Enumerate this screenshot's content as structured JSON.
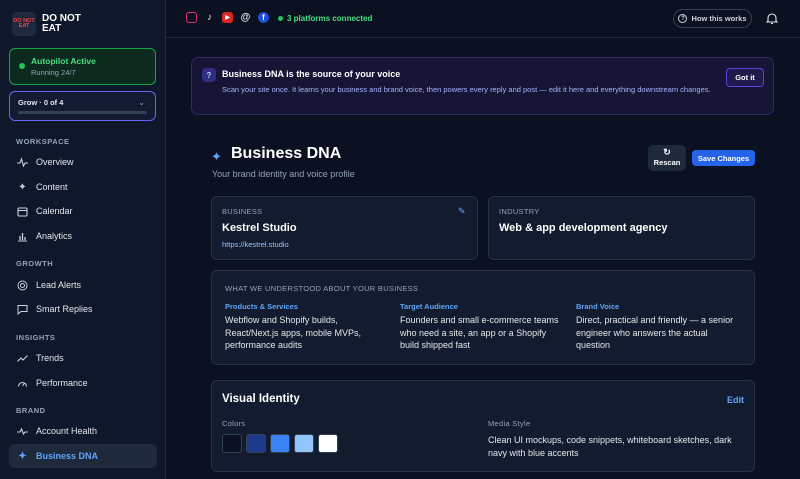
{
  "brand": {
    "logo_text": "DO NOT EAT",
    "name": "DO NOT EAT"
  },
  "autopilot": {
    "title": "Autopilot Active",
    "subtitle": "Running 24/7",
    "color": "#22c55e"
  },
  "grow": {
    "label": "Grow · 0 of 4",
    "progress": 0
  },
  "sidebar": {
    "sections": [
      "WORKSPACE",
      "GROWTH",
      "INSIGHTS",
      "BRAND"
    ],
    "items": [
      {
        "label": "Overview",
        "icon": "pulse-icon"
      },
      {
        "label": "Content",
        "icon": "sparkle-icon"
      },
      {
        "label": "Calendar",
        "icon": "calendar-icon"
      },
      {
        "label": "Analytics",
        "icon": "bar-chart-icon"
      },
      {
        "label": "Lead Alerts",
        "icon": "target-icon"
      },
      {
        "label": "Smart Replies",
        "icon": "chat-icon"
      },
      {
        "label": "Trends",
        "icon": "trend-up-icon"
      },
      {
        "label": "Performance",
        "icon": "gauge-icon"
      },
      {
        "label": "Account Health",
        "icon": "heartbeat-icon"
      },
      {
        "label": "Business DNA",
        "icon": "dna-icon",
        "active": true
      }
    ]
  },
  "topbar": {
    "platforms": [
      "instagram-icon",
      "tiktok-icon",
      "youtube-icon",
      "threads-icon",
      "facebook-icon"
    ],
    "connected": "3 platforms connected",
    "how_label": "How this works"
  },
  "banner": {
    "icon": "?",
    "title": "Business DNA is the source of your voice",
    "description": "Scan your site once. It learns your business and brand voice, then powers every reply and post — edit it here and everything downstream changes.",
    "button": "Got it"
  },
  "page": {
    "title": "Business DNA",
    "subtitle": "Your brand identity and voice profile",
    "rescan_label": "Rescan",
    "save_label": "Save Changes"
  },
  "business": {
    "label": "BUSINESS",
    "name": "Kestrel Studio",
    "url": "https://kestrel.studio"
  },
  "industry": {
    "label": "INDUSTRY",
    "value": "Web & app development agency"
  },
  "understood": {
    "label": "WHAT WE UNDERSTOOD ABOUT YOUR BUSINESS",
    "columns": [
      {
        "heading": "Products & Services",
        "text": "Webflow and Shopify builds, React/Next.js apps, mobile MVPs, performance audits"
      },
      {
        "heading": "Target Audience",
        "text": "Founders and small e-commerce teams who need a site, an app or a Shopify build shipped fast"
      },
      {
        "heading": "Brand Voice",
        "text": "Direct, practical and friendly — a senior engineer who answers the actual question"
      }
    ]
  },
  "visual": {
    "title": "Visual Identity",
    "edit_label": "Edit",
    "colors_label": "Colors",
    "colors": [
      "#0b1120",
      "#1e3a8a",
      "#3b82f6",
      "#93c5fd",
      "#ffffff"
    ],
    "media_label": "Media Style",
    "media_text": "Clean UI mockups, code snippets, whiteboard sketches, dark navy with blue accents"
  }
}
